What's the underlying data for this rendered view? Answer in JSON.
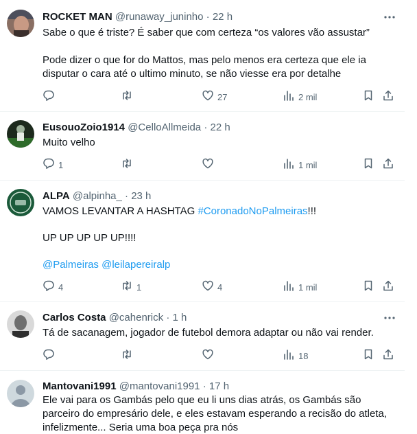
{
  "icons": {
    "reply": "reply-icon",
    "retweet": "retweet-icon",
    "like": "like-icon",
    "views": "views-icon",
    "bookmark": "bookmark-icon",
    "share": "share-icon",
    "more": "more-icon"
  },
  "colors": {
    "link": "#1d9bf0",
    "secondary": "#536471",
    "divider": "#eff3f4"
  },
  "tweets": [
    {
      "name": "ROCKET MAN",
      "handle": "@runaway_juninho",
      "dot": "·",
      "time": "22 h",
      "text1": "Sabe o que é triste? É saber que com certeza “os valores vão assustar”",
      "text2": "Pode dizer o que for do Mattos, mas pelo menos era certeza que ele ia disputar o cara até o ultimo minuto, se não viesse era por detalhe",
      "replies": "",
      "retweets": "",
      "likes": "27",
      "views": "2 mil"
    },
    {
      "name": "EusouoZoio1914",
      "handle": "@CelloAllmeida",
      "dot": "·",
      "time": "22 h",
      "text1": "Muito velho",
      "replies": "1",
      "retweets": "",
      "likes": "",
      "views": "1 mil"
    },
    {
      "name": "ALPA",
      "handle": "@alpinha_",
      "dot": "·",
      "time": "23 h",
      "text1_pre": "VAMOS LEVANTAR A HASHTAG ",
      "text1_tag": "#CoronadoNoPalmeiras",
      "text1_post": "!!!",
      "text2": "UP UP UP UP UP!!!!",
      "mention1": "@Palmeiras",
      "mention2": "@leilapereiralp",
      "replies": "4",
      "retweets": "1",
      "likes": "4",
      "views": "1 mil"
    },
    {
      "name": "Carlos Costa",
      "handle": "@cahenrick",
      "dot": "·",
      "time": "1 h",
      "text1": "Tá de sacanagem, jogador de futebol demora adaptar ou não vai render.",
      "replies": "",
      "retweets": "",
      "likes": "",
      "views": "18"
    },
    {
      "name": "Mantovani1991",
      "handle": "@mantovani1991",
      "dot": "·",
      "time": "17 h",
      "text1": "Ele vai para os Gambás pelo que eu li uns dias atrás, os Gambás são parceiro do empresário dele, e eles estavam esperando a recisão do atleta, infelizmente... Seria uma boa peça pra nós"
    }
  ]
}
